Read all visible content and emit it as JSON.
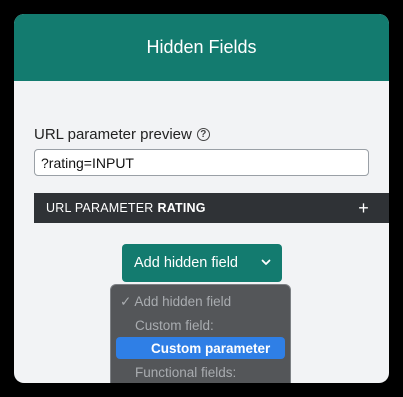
{
  "panel": {
    "title": "Hidden Fields"
  },
  "url_preview": {
    "label": "URL parameter preview",
    "help_icon": "?",
    "value": "?rating=INPUT"
  },
  "param_section": {
    "label_prefix": "URL PARAMETER",
    "label_name": "RATING",
    "expand_icon": "+"
  },
  "add_button": {
    "label": "Add hidden field",
    "icon": "chevron-down-icon"
  },
  "dropdown": {
    "options": [
      {
        "label": "✓ Add hidden field"
      },
      {
        "label": "Custom field:"
      },
      {
        "label": "Custom parameter"
      },
      {
        "label": "Functional fields:"
      }
    ]
  },
  "colors": {
    "brand": "#137b6f",
    "panel_bg": "#f2f3f5",
    "bar_bg": "#2f3236",
    "highlight": "#2f7fe6"
  }
}
